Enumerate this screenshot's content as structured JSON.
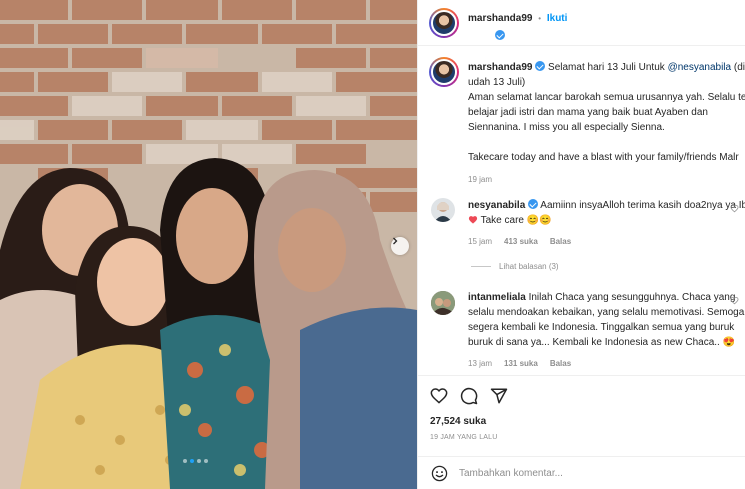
{
  "post": {
    "author": "marshanda99",
    "follow_separator": "•",
    "follow_label": "Ikuti",
    "caption": {
      "greeting": "Selamat hari 13 Juli Untuk",
      "mention": "@nesyanabila",
      "line1_tail": "(di",
      "line2": "udah 13 Juli)",
      "line3": "Aman selamat lancar barokah semua urusannya yah. Selalu te",
      "line4": "belajar jadi istri dan mama yang baik buat Ayaben dan",
      "line5": "Siennanina. I miss you all especially Sienna.",
      "line6": "Takecare today and have a blast with your family/friends Malr",
      "time": "19 jam"
    },
    "likes": "27,524 suka",
    "posted_ago": "19 JAM YANG LALU",
    "comment_placeholder": "Tambahkan komentar..."
  },
  "comments": [
    {
      "username": "nesyanabila",
      "verified": true,
      "line1": "Aamiinn insyaAlloh terima kasih doa2nya ya Ib",
      "line2": "Take care 😊😊",
      "time": "15 jam",
      "likes": "413 suka",
      "reply": "Balas",
      "view_replies": "Lihat balasan (3)"
    },
    {
      "username": "intanmeliala",
      "verified": false,
      "line1": "Inilah Chaca yang sesungguhnya. Chaca yang",
      "line2": "selalu mendoakan kebaikan, yang selalu memotivasi. Semoga",
      "line3": "segera kembali ke Indonesia. Tinggalkan semua yang buruk",
      "line4": "buruk di sana ya... Kembali ke Indonesia as new Chaca.. 😍",
      "time": "13 jam",
      "likes": "131 suka",
      "reply": "Balas"
    }
  ],
  "icons": {
    "like": "heart-icon",
    "comment": "comment-icon",
    "share": "send-icon",
    "emoji": "emoji-icon",
    "next": "chevron-right-icon",
    "verified": "verified-badge-icon"
  },
  "colors": {
    "accent": "#0095f6",
    "verified": "#3897f0",
    "heart": "#ed4956",
    "text": "#262626",
    "muted": "#8e8e8e"
  },
  "carousel": {
    "current": 2,
    "total": 4
  }
}
